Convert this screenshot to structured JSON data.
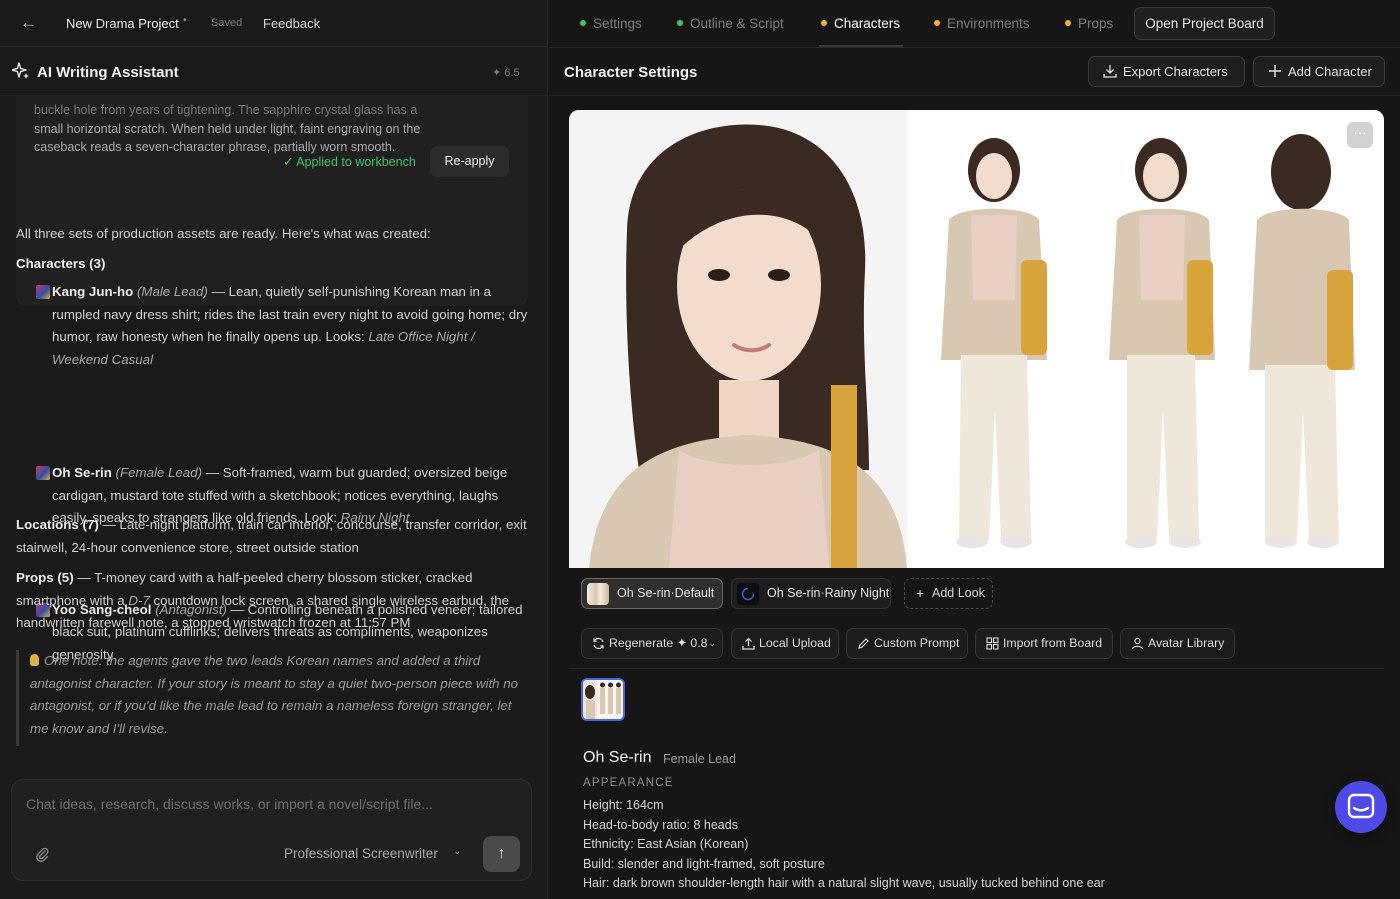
{
  "topbar": {
    "project_title": "New Drama Project",
    "saved": "Saved",
    "feedback": "Feedback"
  },
  "assistant": {
    "title": "AI Writing Assistant",
    "version": "✦ 6.5"
  },
  "applied_card": {
    "text_cut": "buckle hole from years of tightening. The sapphire crystal glass has a",
    "text": "small horizontal scratch. When held under light, faint engraving on the caseback reads a seven-character phrase, partially worn smooth.",
    "applied_label": "✓ Applied to workbench",
    "reapply_label": "Re-apply"
  },
  "message": {
    "intro": "All three sets of production assets are ready. Here's what was created:",
    "characters_heading": "Characters (3)",
    "characters": [
      {
        "name": "Kang Jun-ho",
        "role": "(Male Lead)",
        "desc": " — Lean, quietly self-punishing Korean man in a rumpled navy dress shirt; rides the last train every night to avoid going home; dry humor, raw honesty when he finally opens up. Looks: ",
        "looks": "Late Office Night / Weekend Casual"
      },
      {
        "name": "Oh Se-rin",
        "role": "(Female Lead)",
        "desc": " — Soft-framed, warm but guarded; oversized beige cardigan, mustard tote stuffed with a sketchbook; notices everything, laughs easily, speaks to strangers like old friends. Look: ",
        "looks": "Rainy Night"
      },
      {
        "name": "Yoo Sang-cheol",
        "role": "(Antagonist)",
        "desc": " — Controlling beneath a polished veneer; tailored black suit, platinum cufflinks; delivers threats as compliments, weaponizes generosity",
        "looks": ""
      }
    ],
    "locations_heading": "Locations (7)",
    "locations_text": " — Late-night platform, train car interior, concourse, transfer corridor, exit stairwell, 24-hour convenience store, street outside station",
    "props_heading": "Props (5)",
    "props_text_1": " — T-money card with a half-peeled cherry blossom sticker, cracked smartphone with a ",
    "props_italic": "D-7",
    "props_text_2": " countdown lock screen, a shared single wireless earbud, the handwritten farewell note, a stopped wristwatch frozen at 11:57 PM",
    "note": "One note: the agents gave the two leads Korean names and added a third antagonist character. If your story is meant to stay a quiet two-person piece with no antagonist, or if you'd like the male lead to remain a nameless foreign stranger, let me know and I'll revise."
  },
  "composer": {
    "placeholder": "Chat ideas, research, discuss works, or import a novel/script file...",
    "mode": "Professional Screenwriter"
  },
  "nav": {
    "tabs": [
      {
        "label": "Settings",
        "dot": "#3fc56a"
      },
      {
        "label": "Outline & Script",
        "dot": "#3fc56a"
      },
      {
        "label": "Characters",
        "dot": "#f2b531"
      },
      {
        "label": "Environments",
        "dot": "#f2b531"
      },
      {
        "label": "Props",
        "dot": "#f2b531"
      }
    ],
    "open_board": "Open Project Board"
  },
  "settings": {
    "title": "Character Settings",
    "export_label": "Export Characters",
    "add_label": "Add Character"
  },
  "looks": {
    "active": "Oh Se-rin·Default",
    "second": "Oh Se-rin·Rainy Night",
    "add": "Add Look"
  },
  "tools": {
    "regenerate": "Regenerate ✦ 0.8",
    "local_upload": "Local Upload",
    "custom_prompt": "Custom Prompt",
    "import_board": "Import from Board",
    "avatar_library": "Avatar Library"
  },
  "character": {
    "name": "Oh Se-rin",
    "role": "Female Lead",
    "section": "APPEARANCE",
    "attributes": [
      "Height: 164cm",
      "Head-to-body ratio: 8 heads",
      "Ethnicity: East Asian (Korean)",
      "Build: slender and light-framed, soft posture",
      "Hair: dark brown shoulder-length hair with a natural slight wave, usually tucked behind one ear"
    ]
  },
  "colors": {
    "accent_blue": "#4f49e8",
    "applied_green": "#3fc56a",
    "status_orange": "#f2b531"
  }
}
